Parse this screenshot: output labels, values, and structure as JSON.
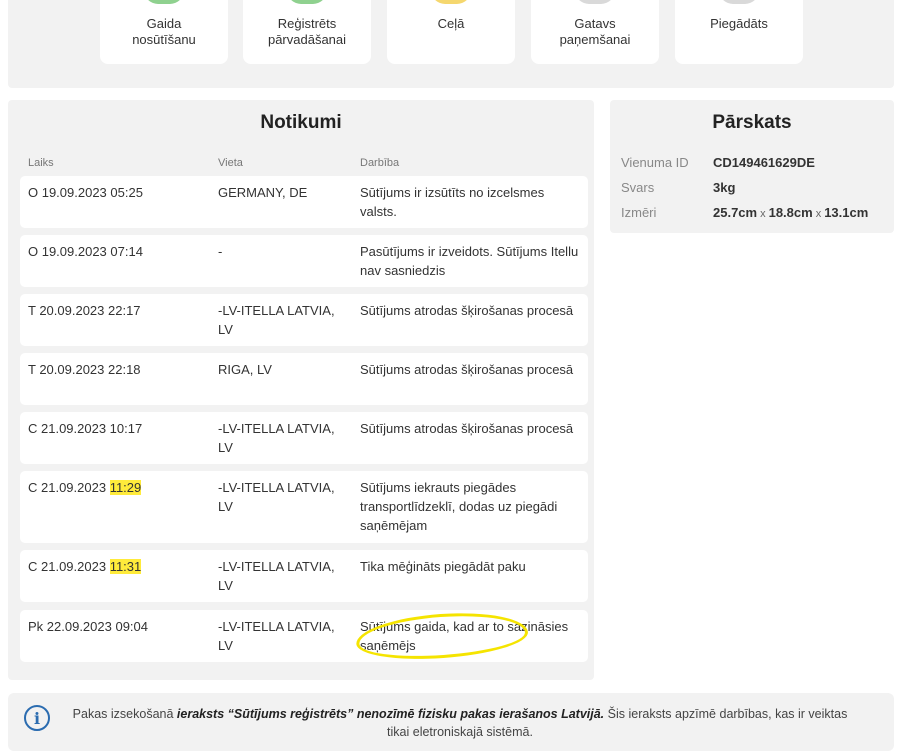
{
  "status_steps": [
    {
      "label": "Gaida\nnosūtīšanu",
      "color": "#8fd18f"
    },
    {
      "label": "Reģistrēts\npārvadāšanai",
      "color": "#8fd18f"
    },
    {
      "label": "Ceļā",
      "color": "#f5d76e"
    },
    {
      "label": "Gatavs\npaņemšanai",
      "color": "#d9d9d9"
    },
    {
      "label": "Piegādāts",
      "color": "#d9d9d9"
    }
  ],
  "events": {
    "title": "Notikumi",
    "columns": {
      "time": "Laiks",
      "place": "Vieta",
      "action": "Darbība"
    },
    "rows": [
      {
        "time_pre": "O 19.09.2023 05:25",
        "time_hl": "",
        "place": "GERMANY, DE",
        "action": "Sūtījums ir izsūtīts no izcelsmes valsts."
      },
      {
        "time_pre": "O 19.09.2023 07:14",
        "time_hl": "",
        "place": "-",
        "action": "Pasūtījums ir izveidots. Sūtījums Itellu nav sasniedzis"
      },
      {
        "time_pre": "T 20.09.2023 22:17",
        "time_hl": "",
        "place": "-LV-ITELLA LATVIA, LV",
        "action": "Sūtījums atrodas šķirošanas procesā"
      },
      {
        "time_pre": "T 20.09.2023 22:18",
        "time_hl": "",
        "place": "RIGA, LV",
        "action": "Sūtījums atrodas šķirošanas procesā"
      },
      {
        "time_pre": "C 21.09.2023 10:17",
        "time_hl": "",
        "place": "-LV-ITELLA LATVIA, LV",
        "action": "Sūtījums atrodas šķirošanas procesā"
      },
      {
        "time_pre": "C 21.09.2023 ",
        "time_hl": "11:29",
        "place": "-LV-ITELLA LATVIA, LV",
        "action": "Sūtījums iekrauts piegādes transportlīdzeklī, dodas uz piegādi saņēmējam"
      },
      {
        "time_pre": "C 21.09.2023 ",
        "time_hl": "11:31",
        "place": "-LV-ITELLA LATVIA, LV",
        "action": "Tika mēģināts piegādāt paku"
      },
      {
        "time_pre": "Pk 22.09.2023 09:04",
        "time_hl": "",
        "place": "-LV-ITELLA LATVIA, LV",
        "action": "Sūtījums gaida, kad ar to sazināsies saņēmējs"
      }
    ]
  },
  "overview": {
    "title": "Pārskats",
    "id_label": "Vienuma ID",
    "id_value": "CD149461629DE",
    "weight_label": "Svars",
    "weight_value": "3kg",
    "dims_label": "Izmēri",
    "dim1": "25.7cm",
    "dim2": "18.8cm",
    "dim3": "13.1cm",
    "dims_sep": "x"
  },
  "notice": {
    "icon": "info-icon",
    "text_1": "Pakas izsekošanā ",
    "bold_1": "ieraksts “Sūtījums reģistrēts” nenozīmē fizisku pakas ierašanos Latvijā.",
    "text_2": " Šis ieraksts apzīmē darbības, kas ir veiktas tikai eletroniskajā sistēmā."
  }
}
